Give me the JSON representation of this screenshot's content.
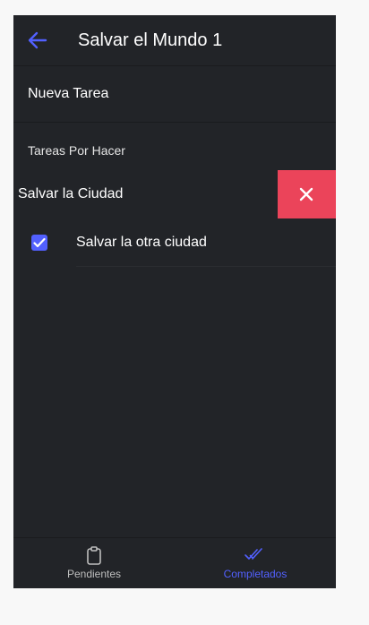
{
  "header": {
    "title": "Salvar el Mundo 1",
    "back_icon": "arrow-back-icon"
  },
  "new_task": {
    "placeholder": "Nueva Tarea"
  },
  "section": {
    "header": "Tareas Por Hacer"
  },
  "tasks": [
    {
      "label": "Salvar la Ciudad",
      "state": "swiped-open",
      "option_icon": "close-icon"
    },
    {
      "label": "Salvar la otra ciudad",
      "checked": true
    }
  ],
  "tabs": [
    {
      "label": "Pendientes",
      "icon": "clipboard-icon",
      "selected": false
    },
    {
      "label": "Completados",
      "icon": "done-all-icon",
      "selected": true
    }
  ],
  "colors": {
    "background": "#222428",
    "primary": "#5260ff",
    "danger": "#eb445a",
    "text": "#ffffff",
    "tab_inactive": "#bfbfbf"
  }
}
